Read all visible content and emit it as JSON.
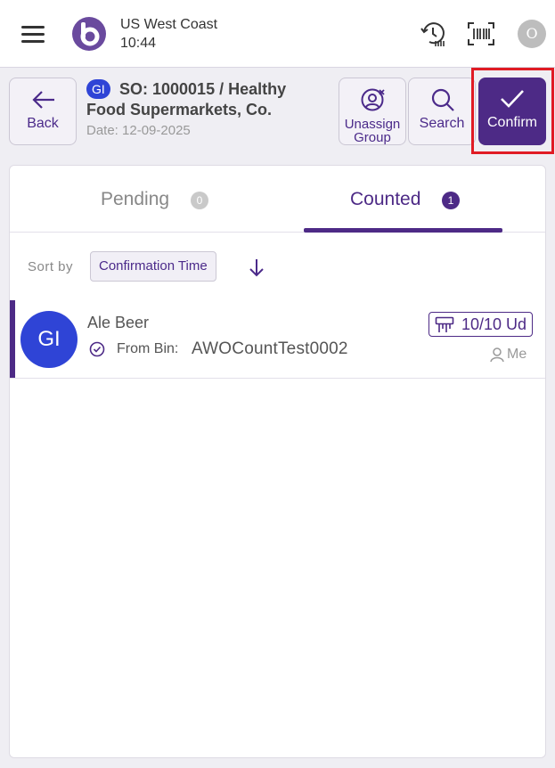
{
  "header": {
    "location": "US West Coast",
    "time": "10:44",
    "user_initial": "O"
  },
  "order": {
    "type_badge": "GI",
    "title": "SO: 1000015 / Healthy Food Supermarkets, Co.",
    "date": "Date: 12-09-2025"
  },
  "actions": {
    "back_label": "Back",
    "unassign_label": "Unassign Group",
    "search_label": "Search",
    "confirm_label": "Confirm"
  },
  "tabs": [
    {
      "label": "Pending",
      "count": "0",
      "active": false
    },
    {
      "label": "Counted",
      "count": "1",
      "active": true
    }
  ],
  "sort": {
    "label": "Sort by",
    "field": "Confirmation Time"
  },
  "items": [
    {
      "avatar": "GI",
      "name": "Ale Beer",
      "bin_label": "From Bin:",
      "bin": "AWOCountTest0002",
      "quantity": "10/10 Ud",
      "assignee": "Me"
    }
  ],
  "colors": {
    "accent": "#4d2a86",
    "badge_blue": "#2f44d6",
    "highlight_red": "#e01b24"
  }
}
